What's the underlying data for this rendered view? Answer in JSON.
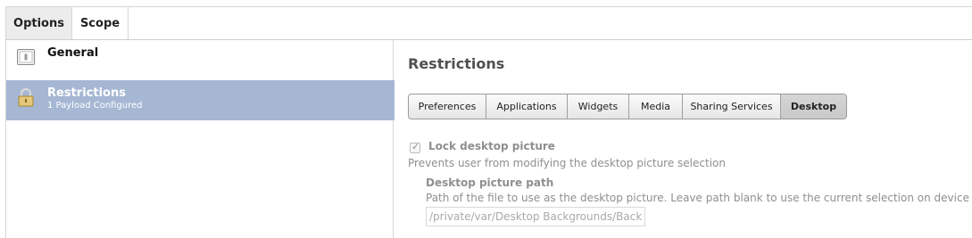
{
  "top_tabs": [
    {
      "label": "Options"
    },
    {
      "label": "Scope"
    }
  ],
  "sidebar": {
    "items": [
      {
        "title": "General",
        "icon": "device-icon"
      },
      {
        "title": "Restrictions",
        "subtitle": "1 Payload Configured",
        "icon": "padlock-icon"
      }
    ]
  },
  "main": {
    "title": "Restrictions",
    "segments": [
      {
        "label": "Preferences"
      },
      {
        "label": "Applications"
      },
      {
        "label": "Widgets"
      },
      {
        "label": "Media"
      },
      {
        "label": "Sharing Services"
      },
      {
        "label": "Desktop",
        "active": true
      }
    ],
    "lock_checkbox": {
      "label": "Lock desktop picture",
      "checked": true,
      "description": "Prevents user from modifying the desktop picture selection"
    },
    "path_field": {
      "label": "Desktop picture path",
      "description": "Path of the file to use as the desktop picture. Leave path blank to use the current selection on device",
      "value": "/private/var/Desktop Backgrounds/Backgrc"
    }
  },
  "colors": {
    "selected_row": "#a6b7d4",
    "title_text": "#505050",
    "muted_text": "#8f8f8f"
  }
}
